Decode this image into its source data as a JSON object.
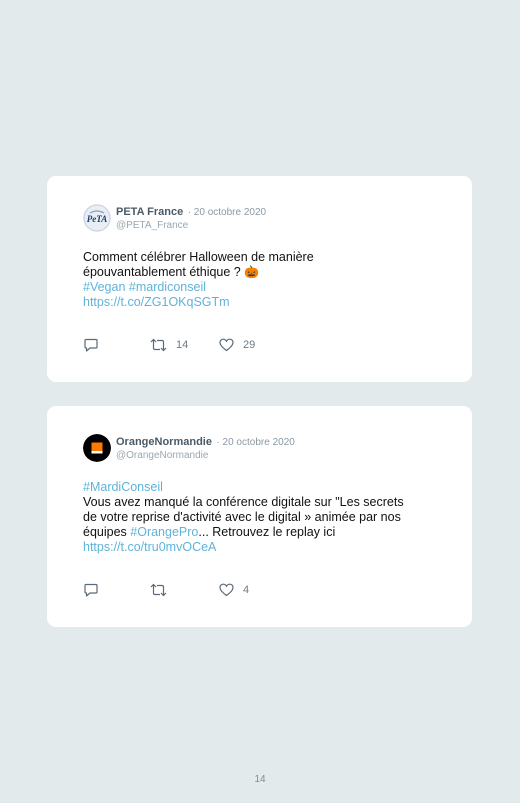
{
  "tweets": [
    {
      "name": "PETA France",
      "date": "· 20 octobre 2020",
      "handle": "@PETA_France",
      "avatar_text": "PeTA",
      "text1": "Comment célébrer Halloween de manière",
      "text2": "épouvantablement éthique ? ",
      "emoji": "🎃",
      "hashtags": "#Vegan #mardiconseil",
      "url": "https://t.co/ZG1OKqSGTm",
      "retweets": "14",
      "likes": "29"
    },
    {
      "name": "OrangeNormandie",
      "date": "· 20 octobre 2020",
      "handle": "@OrangeNormandie",
      "hashtag": "#MardiConseil",
      "line1": "Vous avez manqué la conférence digitale sur \"Les secrets",
      "line2": "de votre reprise d'activité avec le digital » animée par nos",
      "line3_pre": "équipes ",
      "line3_link": "#OrangePro",
      "line3_post": "... Retrouvez le replay ici",
      "url": "https://t.co/tru0mvOCeA",
      "retweets": "",
      "likes": "4"
    }
  ],
  "page_number": "14"
}
